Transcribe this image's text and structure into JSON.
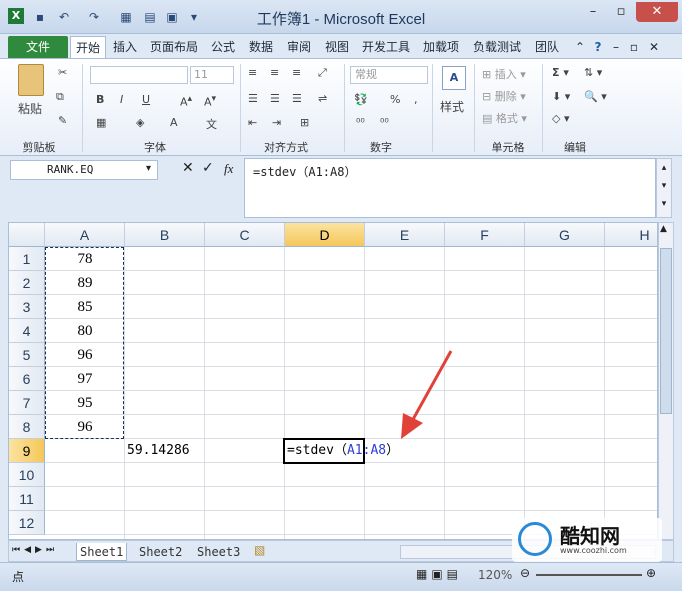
{
  "window": {
    "title": "工作簿1 - Microsoft Excel"
  },
  "ribbon": {
    "file_tab": "文件",
    "tabs": [
      "开始",
      "插入",
      "页面布局",
      "公式",
      "数据",
      "审阅",
      "视图",
      "开发工具",
      "加载项",
      "负载测试",
      "团队"
    ],
    "clipboard": {
      "paste": "粘贴",
      "label": "剪贴板"
    },
    "font": {
      "size": "11",
      "label": "字体",
      "bold": "B",
      "italic": "I",
      "underline": "U"
    },
    "alignment": {
      "label": "对齐方式"
    },
    "number": {
      "format": "常规",
      "label": "数字",
      "percent": "%"
    },
    "styles": {
      "label": "样式"
    },
    "cells": {
      "insert": "插入",
      "delete": "删除",
      "format": "格式",
      "label": "单元格"
    },
    "editing": {
      "label": "编辑"
    }
  },
  "formula_bar": {
    "name_box": "RANK.EQ",
    "fx": "fx",
    "formula": "=stdev（A1:A8）"
  },
  "grid": {
    "columns": [
      "A",
      "B",
      "C",
      "D",
      "E",
      "F",
      "G",
      "H"
    ],
    "rows": [
      "1",
      "2",
      "3",
      "4",
      "5",
      "6",
      "7",
      "8",
      "9",
      "10",
      "11",
      "12"
    ],
    "a_values": [
      "78",
      "89",
      "85",
      "80",
      "96",
      "97",
      "95",
      "96"
    ],
    "b9": "59.14286",
    "d9_prefix": "=stdev（",
    "d9_ref": "A1:A8",
    "d9_suffix": "）"
  },
  "sheets": [
    "Sheet1",
    "Sheet2",
    "Sheet3"
  ],
  "status": {
    "mode": "点",
    "zoom": "120%"
  },
  "watermark": {
    "name": "酷知网",
    "url": "www.coozhi.com"
  },
  "colors": {
    "ref_blue": "#2b3fd6",
    "arrow_red": "#e0423a",
    "file_green": "#2f8a3e",
    "selected_header": "#f5c75a"
  }
}
